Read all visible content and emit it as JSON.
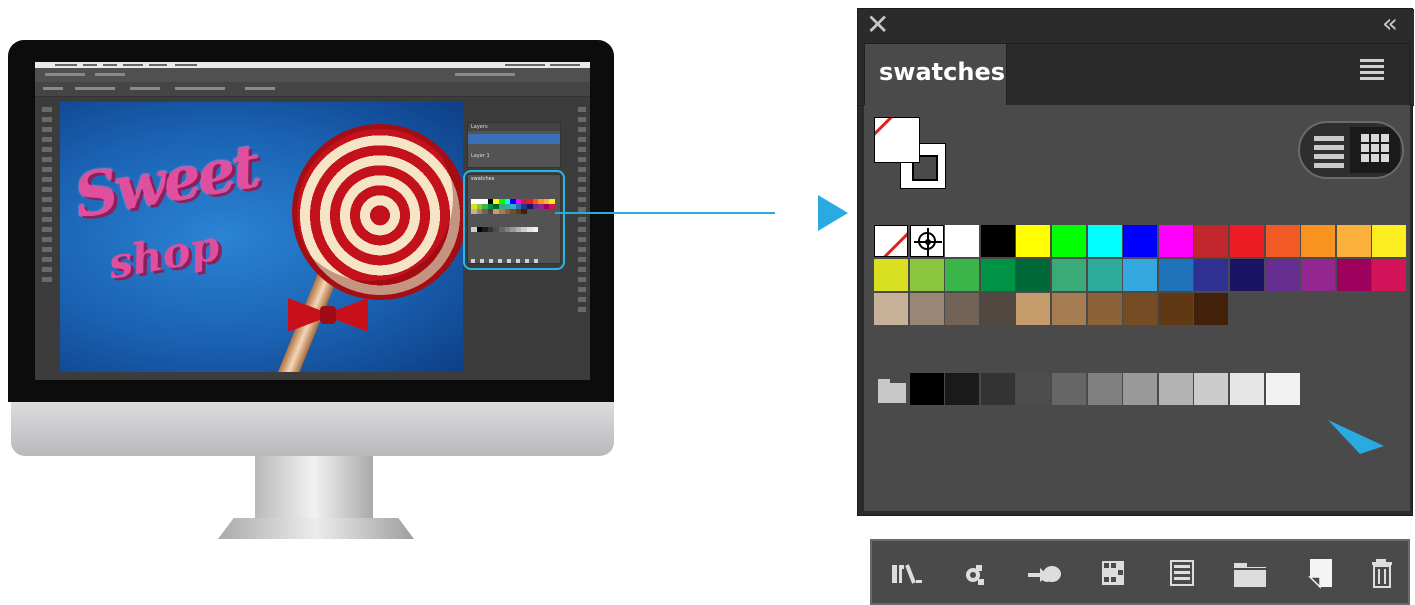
{
  "panel": {
    "title": "swatches",
    "close_icon": "close-icon",
    "collapse_icon": "collapse-icon",
    "menu_icon": "panel-menu-icon"
  },
  "view_modes": [
    "list-view",
    "grid-view"
  ],
  "selected_view": "grid-view",
  "colors": {
    "accent": "#29abe2",
    "panel_bg": "#4a4a4a",
    "panel_dark": "#2b2b2b"
  },
  "swatches": {
    "row1": [
      "none",
      "registration",
      "#ffffff",
      "#000000",
      "#ffff00",
      "#00ff00",
      "#00ffff",
      "#0000ff",
      "#ff00ff",
      "#c1272d",
      "#ed1c24",
      "#f15a24",
      "#f7931e",
      "#fbb03b",
      "#fcee21"
    ],
    "row2": [
      "#d9e021",
      "#8cc63f",
      "#39b54a",
      "#009245",
      "#006837",
      "#3aaa76",
      "#2eab9c",
      "#35a8e0",
      "#2173b9",
      "#2e3192",
      "#1b1464",
      "#662d91",
      "#93278f",
      "#9e005d",
      "#d4145a"
    ],
    "row3": [
      "#c7b299",
      "#998675",
      "#736357",
      "#534741",
      "#c69c6d",
      "#a67c52",
      "#8c6239",
      "#754c24",
      "#603813",
      "#42210b"
    ],
    "grays": [
      "#000000",
      "#1a1a1a",
      "#333333",
      "#4d4d4d",
      "#666666",
      "#808080",
      "#999999",
      "#b3b3b3",
      "#cccccc",
      "#e6e6e6",
      "#f2f2f2"
    ]
  },
  "bottom_toolbar": [
    {
      "name": "swatch-libraries-menu-button",
      "icon": "library-icon"
    },
    {
      "name": "show-swatch-kinds-button",
      "icon": "swatch-kinds-icon"
    },
    {
      "name": "cc-libraries-button",
      "icon": "cloud-icon"
    },
    {
      "name": "swatch-options-button",
      "icon": "swatch-options-icon"
    },
    {
      "name": "color-group-button",
      "icon": "color-group-icon"
    },
    {
      "name": "new-color-group-button",
      "icon": "folder-icon"
    },
    {
      "name": "new-swatch-button",
      "icon": "new-swatch-icon"
    },
    {
      "name": "delete-swatch-button",
      "icon": "trash-icon"
    }
  ],
  "screen": {
    "artwork_text_1": "Sweet",
    "artwork_text_2": "shop",
    "mini_layers_title": "Layers",
    "mini_layer_name": "Layer 1",
    "mini_panel_title": "swatches"
  }
}
